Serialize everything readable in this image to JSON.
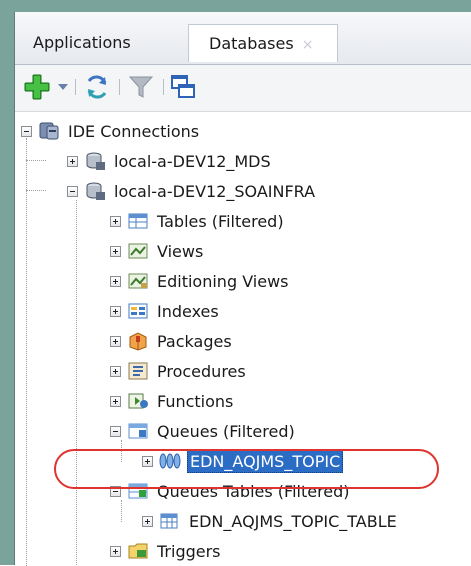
{
  "tabs": [
    {
      "label": "Applications",
      "active": false
    },
    {
      "label": "Databases",
      "active": true,
      "close_glyph": "×"
    }
  ],
  "toolbar": {
    "buttons": [
      "add-icon",
      "dropdown-arrow-icon",
      "refresh-icon",
      "filter-icon",
      "windows-icon"
    ]
  },
  "tree": {
    "root": {
      "label": "IDE Connections",
      "icon": "connections-icon"
    },
    "connections": [
      {
        "label": "local-a-DEV12_MDS",
        "expanded": false
      },
      {
        "label": "local-a-DEV12_SOAINFRA",
        "expanded": true
      }
    ],
    "items": [
      {
        "label": "Tables (Filtered)",
        "icon": "tables-icon"
      },
      {
        "label": "Views",
        "icon": "views-icon"
      },
      {
        "label": "Editioning Views",
        "icon": "editioning-views-icon"
      },
      {
        "label": "Indexes",
        "icon": "indexes-icon"
      },
      {
        "label": "Packages",
        "icon": "packages-icon"
      },
      {
        "label": "Procedures",
        "icon": "procedures-icon"
      },
      {
        "label": "Functions",
        "icon": "functions-icon"
      },
      {
        "label": "Queues (Filtered)",
        "icon": "queues-icon"
      },
      {
        "label": "EDN_AQJMS_TOPIC",
        "icon": "queue-icon",
        "selected": true
      },
      {
        "label": "Queues Tables (Filtered)",
        "icon": "queue-tables-icon"
      },
      {
        "label": "EDN_AQJMS_TOPIC_TABLE",
        "icon": "table-icon"
      },
      {
        "label": "Triggers",
        "icon": "triggers-icon"
      }
    ]
  },
  "colors": {
    "selection": "#2b6cc4",
    "callout": "#e0322e",
    "frame": "#7aa39b"
  }
}
